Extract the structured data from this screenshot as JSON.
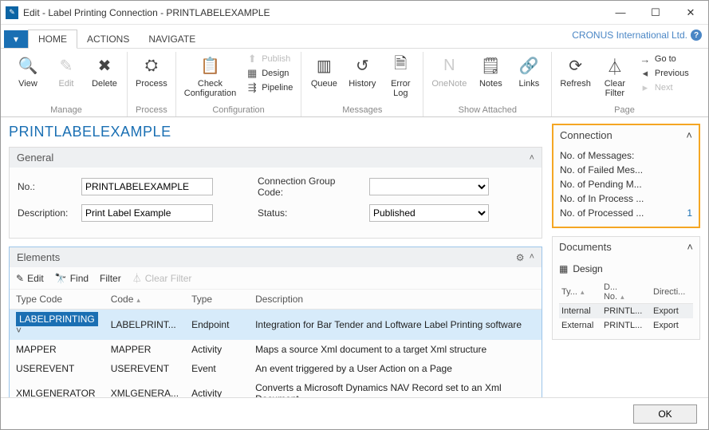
{
  "window": {
    "title": "Edit - Label Printing Connection - PRINTLABELEXAMPLE"
  },
  "tabs": {
    "file": "▾",
    "home": "HOME",
    "actions": "ACTIONS",
    "navigate": "NAVIGATE"
  },
  "tenant": "CRONUS International Ltd.",
  "ribbon": {
    "view": "View",
    "edit": "Edit",
    "delete": "Delete",
    "process": "Process",
    "check_cfg": "Check\nConfiguration",
    "publish": "Publish",
    "design": "Design",
    "pipeline": "Pipeline",
    "queue": "Queue",
    "history": "History",
    "errorlog": "Error\nLog",
    "onenote": "OneNote",
    "notes": "Notes",
    "links": "Links",
    "refresh": "Refresh",
    "clearfilter": "Clear\nFilter",
    "goto": "Go to",
    "previous": "Previous",
    "next": "Next",
    "groups": {
      "manage": "Manage",
      "process": "Process",
      "cfg": "Configuration",
      "msg": "Messages",
      "showatt": "Show Attached",
      "page": "Page"
    }
  },
  "page_title": "PRINTLABELEXAMPLE",
  "general": {
    "title": "General",
    "no_label": "No.:",
    "no_value": "PRINTLABELEXAMPLE",
    "desc_label": "Description:",
    "desc_value": "Print Label Example",
    "group_label": "Connection Group Code:",
    "group_value": "",
    "status_label": "Status:",
    "status_value": "Published"
  },
  "elements": {
    "title": "Elements",
    "toolbar": {
      "edit": "Edit",
      "find": "Find",
      "filter": "Filter",
      "clearfilter": "Clear Filter"
    },
    "cols": {
      "typecode": "Type Code",
      "code": "Code",
      "type": "Type",
      "desc": "Description"
    },
    "rows": [
      {
        "typecode": "LABELPRINTING",
        "code": "LABELPRINT...",
        "type": "Endpoint",
        "desc": "Integration for Bar Tender and Loftware Label Printing software"
      },
      {
        "typecode": "MAPPER",
        "code": "MAPPER",
        "type": "Activity",
        "desc": "Maps a source Xml document to a target Xml structure"
      },
      {
        "typecode": "USEREVENT",
        "code": "USEREVENT",
        "type": "Event",
        "desc": "An event triggered by a User Action on a Page"
      },
      {
        "typecode": "XMLGENERATOR",
        "code": "XMLGENERA...",
        "type": "Activity",
        "desc": "Converts a Microsoft Dynamics NAV Record set to an Xml Document."
      }
    ]
  },
  "factbox_conn": {
    "title": "Connection",
    "lines": [
      {
        "label": "No. of Messages:",
        "value": ""
      },
      {
        "label": "No. of Failed Mes...",
        "value": ""
      },
      {
        "label": "No. of Pending M...",
        "value": ""
      },
      {
        "label": "No. of In Process ...",
        "value": ""
      },
      {
        "label": "No. of Processed ...",
        "value": "1"
      }
    ]
  },
  "factbox_docs": {
    "title": "Documents",
    "action": "Design",
    "cols": {
      "type": "Ty...",
      "docno": "D...\nNo.",
      "dir": "Directi..."
    },
    "rows": [
      {
        "type": "Internal",
        "docno": "PRINTL...",
        "dir": "Export"
      },
      {
        "type": "External",
        "docno": "PRINTL...",
        "dir": "Export"
      }
    ]
  },
  "footer": {
    "ok": "OK"
  }
}
